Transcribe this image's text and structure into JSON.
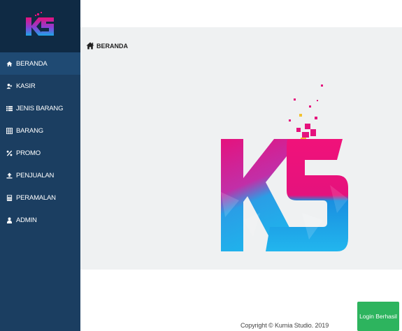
{
  "app": {
    "logo_text": "KS"
  },
  "sidebar": {
    "items": [
      {
        "label": "BERANDA",
        "icon": "home-icon"
      },
      {
        "label": "KASIR",
        "icon": "user-plus-icon"
      },
      {
        "label": "JENIS BARANG",
        "icon": "list-icon"
      },
      {
        "label": "BARANG",
        "icon": "table-icon"
      },
      {
        "label": "PROMO",
        "icon": "percent-icon"
      },
      {
        "label": "PENJUALAN",
        "icon": "upload-icon"
      },
      {
        "label": "PERAMALAN",
        "icon": "calculator-icon"
      },
      {
        "label": "ADMIN",
        "icon": "user-icon"
      }
    ]
  },
  "breadcrumb": {
    "label": "BERANDA"
  },
  "footer": {
    "copyright": "Copyright © Kurnia Studio. 2019"
  },
  "toast": {
    "message": "Login Berhasil"
  },
  "colors": {
    "sidebar": "#1b3e61",
    "toast": "#2db45e",
    "brand_pink": "#e5127d",
    "brand_blue": "#1aa7e8"
  }
}
